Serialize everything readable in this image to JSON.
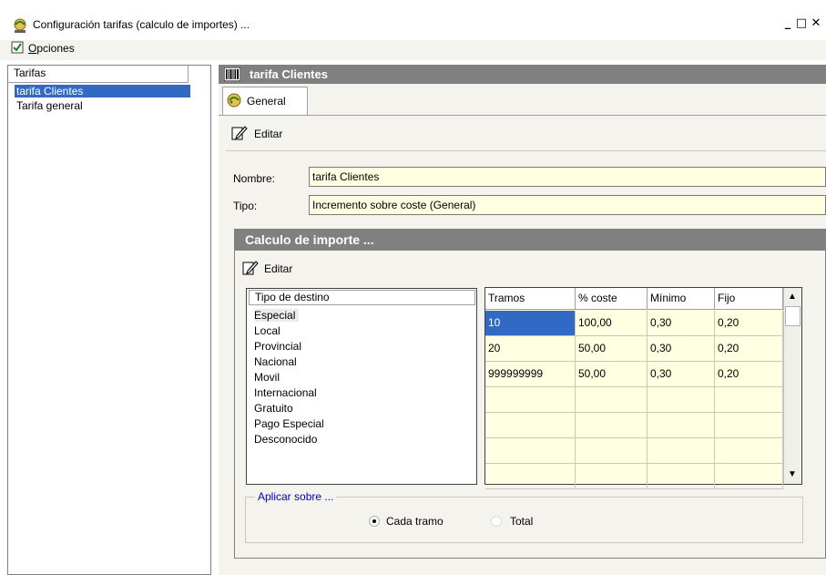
{
  "window": {
    "title": "Configuración tarifas (calculo de importes) ...",
    "minimize_glyph": "_",
    "maximize_glyph": "□",
    "close_glyph": "✕"
  },
  "menu": {
    "opciones_first": "O",
    "opciones_rest": "pciones"
  },
  "tree": {
    "header": "Tarifas",
    "items": [
      "tarifa Clientes",
      "Tarifa general"
    ],
    "selected_index": 0
  },
  "detail": {
    "header": "tarifa Clientes",
    "tab": "General",
    "edit_label": "Editar",
    "nombre_label": "Nombre:",
    "nombre_value": "tarifa Clientes",
    "tipo_label": "Tipo:",
    "tipo_value": "Incremento sobre coste (General)"
  },
  "calc": {
    "header": "Calculo de importe ...",
    "edit_label": "Editar",
    "destinations": {
      "header": "Tipo de destino",
      "items": [
        "Especial",
        "Local",
        "Provincial",
        "Nacional",
        "Movil",
        "Internacional",
        "Gratuito",
        "Pago Especial",
        "Desconocido"
      ],
      "selected_index": 0
    },
    "grid": {
      "columns": [
        "Tramos",
        "% coste",
        "Mínimo",
        "Fijo"
      ],
      "rows": [
        [
          "10",
          "100,00",
          "0,30",
          "0,20"
        ],
        [
          "20",
          "50,00",
          "0,30",
          "0,20"
        ],
        [
          "999999999",
          "50,00",
          "0,30",
          "0,20"
        ],
        [
          "",
          "",
          "",
          ""
        ],
        [
          "",
          "",
          "",
          ""
        ],
        [
          "",
          "",
          "",
          ""
        ],
        [
          "",
          "",
          "",
          ""
        ]
      ],
      "scroll_up_glyph": "▲",
      "scroll_down_glyph": "▼"
    },
    "aplicar": {
      "label": "Aplicar sobre ...",
      "options": [
        "Cada tramo",
        "Total"
      ],
      "selected_index": 0
    }
  },
  "colors": {
    "selection": "#316ac5",
    "header_gray": "#808080",
    "input_yellow": "#ffffe1",
    "panel_bg": "#f4f3ee"
  }
}
